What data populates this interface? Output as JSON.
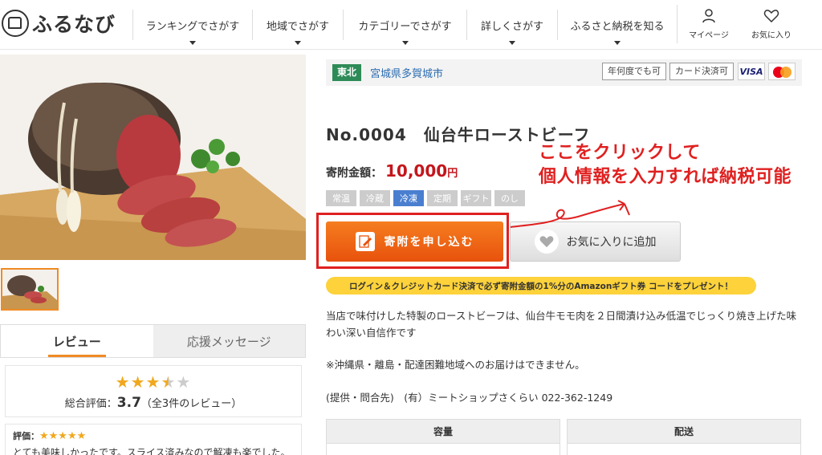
{
  "header": {
    "logo_text": "ふるなび",
    "nav": [
      {
        "label": "ランキングでさがす"
      },
      {
        "label": "地域でさがす"
      },
      {
        "label": "カテゴリーでさがす"
      },
      {
        "label": "詳しくさがす"
      },
      {
        "label": "ふるさと納税を知る"
      }
    ],
    "icons": [
      {
        "label": "マイページ",
        "icon": "user-icon"
      },
      {
        "label": "お気に入り",
        "icon": "heart-icon"
      }
    ]
  },
  "region": {
    "badge": "東北",
    "city": "宮城県多賀城市",
    "pay_tags": [
      "年何度でも可",
      "カード決済可"
    ],
    "cards": [
      "VISA",
      "MasterCard"
    ]
  },
  "product": {
    "title": "No.0004　仙台牛ローストビーフ",
    "price_label": "寄附金額：",
    "price_value": "10,000",
    "price_unit": "円",
    "tags": [
      {
        "label": "常温",
        "active": false
      },
      {
        "label": "冷蔵",
        "active": false
      },
      {
        "label": "冷凍",
        "active": true
      },
      {
        "label": "定期",
        "active": false
      },
      {
        "label": "ギフト",
        "active": false
      },
      {
        "label": "のし",
        "active": false
      }
    ],
    "apply_label": "寄附を申し込む",
    "favorite_label": "お気に入りに追加",
    "promo": "ログイン＆クレジットカード決済で必ず寄附金額の1%分のAmazonギフト券 コードをプレゼント！",
    "description": "当店で味付けした特製のローストビーフは、仙台牛モモ肉を２日間漬け込み低温でじっくり焼き上げた味わい深い自信作です",
    "notice": "※沖縄県・離島・配達困難地域へのお届けはできません。",
    "provider": "(提供・問合先)　(有）ミートショップさくらい 022-362-1249",
    "spec_headers": [
      "容量",
      "配送"
    ]
  },
  "annotation": {
    "line1": "ここをクリックして",
    "line2": "個人情報を入力すれば納税可能"
  },
  "reviews": {
    "tabs": [
      "レビュー",
      "応援メッセージ"
    ],
    "rating_stars": 3.5,
    "overall_label": "総合評価：",
    "overall_value": "3.7",
    "overall_count": "（全3件のレビュー）",
    "items": [
      {
        "label": "評価：",
        "stars": 5,
        "text": "とても美味しかったです。スライス済みなので解凍も楽でした。"
      }
    ]
  },
  "colors": {
    "accent_orange": "#f08a24",
    "price_red": "#c3161c",
    "annotation_red": "#e02020",
    "region_green": "#2e8b57",
    "promo_yellow": "#fdd23a"
  }
}
